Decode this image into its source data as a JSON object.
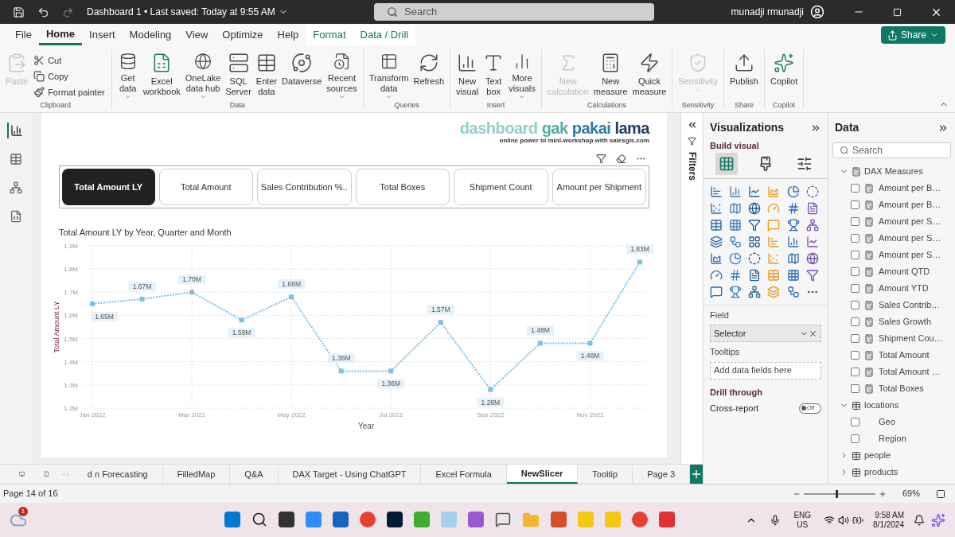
{
  "title_bar": {
    "document": "Dashboard 1 • Last saved: Today at 9:55 AM",
    "search": {
      "placeholder": "Search"
    },
    "user": "munadji rmunadji"
  },
  "menu_tabs": [
    {
      "label": "File",
      "selected": false
    },
    {
      "label": "Home",
      "selected": true
    },
    {
      "label": "Insert",
      "selected": false
    },
    {
      "label": "Modeling",
      "selected": false
    },
    {
      "label": "View",
      "selected": false
    },
    {
      "label": "Optimize",
      "selected": false
    },
    {
      "label": "Help",
      "selected": false
    },
    {
      "label": "Format",
      "selected": false,
      "kind": "contextual"
    },
    {
      "label": "Data / Drill",
      "selected": false,
      "kind": "contextual"
    }
  ],
  "share_button": "Share",
  "ribbon": [
    {
      "group": "Clipboard",
      "buttons": [
        {
          "kind": "large",
          "lines": [
            "Paste"
          ],
          "disabled": true,
          "dropdown": false
        },
        {
          "kind": "small",
          "lines": [
            "Cut"
          ],
          "disabled": false
        },
        {
          "kind": "small",
          "lines": [
            "Copy"
          ],
          "disabled": false
        },
        {
          "kind": "small",
          "lines": [
            "Format painter"
          ],
          "disabled": false
        }
      ]
    },
    {
      "group": "Data",
      "buttons": [
        {
          "kind": "large",
          "lines": [
            "Get",
            "data"
          ],
          "disabled": false,
          "dropdown": true
        },
        {
          "kind": "large",
          "lines": [
            "Excel",
            "workbook"
          ],
          "disabled": false,
          "dropdown": false
        },
        {
          "kind": "large",
          "lines": [
            "OneLake",
            "data hub"
          ],
          "disabled": false,
          "dropdown": true
        },
        {
          "kind": "large",
          "lines": [
            "SQL",
            "Server"
          ],
          "disabled": false,
          "dropdown": false
        },
        {
          "kind": "large",
          "lines": [
            "Enter",
            "data"
          ],
          "disabled": false,
          "dropdown": false
        },
        {
          "kind": "large",
          "lines": [
            "Dataverse"
          ],
          "disabled": false,
          "dropdown": false
        },
        {
          "kind": "large",
          "lines": [
            "Recent",
            "sources"
          ],
          "disabled": false,
          "dropdown": true
        }
      ]
    },
    {
      "group": "Queries",
      "buttons": [
        {
          "kind": "large",
          "lines": [
            "Transform",
            "data"
          ],
          "disabled": false,
          "dropdown": true
        },
        {
          "kind": "large",
          "lines": [
            "Refresh"
          ],
          "disabled": false,
          "dropdown": false
        }
      ]
    },
    {
      "group": "Insert",
      "buttons": [
        {
          "kind": "large",
          "lines": [
            "New",
            "visual"
          ],
          "disabled": false,
          "dropdown": false
        },
        {
          "kind": "large",
          "lines": [
            "Text",
            "box"
          ],
          "disabled": false,
          "dropdown": false
        },
        {
          "kind": "large",
          "lines": [
            "More",
            "visuals"
          ],
          "disabled": false,
          "dropdown": true
        }
      ]
    },
    {
      "group": "Calculations",
      "buttons": [
        {
          "kind": "large",
          "lines": [
            "New",
            "calculation"
          ],
          "disabled": true,
          "dropdown": false
        },
        {
          "kind": "large",
          "lines": [
            "New",
            "measure"
          ],
          "disabled": false,
          "dropdown": false
        },
        {
          "kind": "large",
          "lines": [
            "Quick",
            "measure"
          ],
          "disabled": false,
          "dropdown": false
        }
      ]
    },
    {
      "group": "Sensitivity",
      "buttons": [
        {
          "kind": "large",
          "lines": [
            "Sensitivity"
          ],
          "disabled": true,
          "dropdown": true
        }
      ]
    },
    {
      "group": "Share",
      "buttons": [
        {
          "kind": "large",
          "lines": [
            "Publish"
          ],
          "disabled": false,
          "dropdown": false
        }
      ]
    },
    {
      "group": "Copilot",
      "buttons": [
        {
          "kind": "large",
          "lines": [
            "Copilot"
          ],
          "disabled": false,
          "dropdown": false
        }
      ]
    }
  ],
  "left_nav": [
    {
      "selected": true
    },
    {
      "selected": false
    },
    {
      "selected": false
    },
    {
      "selected": false
    }
  ],
  "report": {
    "logo": {
      "title": "dashboard gak pakai lama",
      "tagline": "online power bi mini-workshop with salesgis.com"
    },
    "slicer": [
      {
        "label": "Total Amount LY",
        "selected": true
      },
      {
        "label": "Total Amount",
        "selected": false
      },
      {
        "label": "Sales Contribution %..",
        "selected": false
      },
      {
        "label": "Total Boxes",
        "selected": false
      },
      {
        "label": "Shipment Count",
        "selected": false
      },
      {
        "label": "Amount per Shipment",
        "selected": false
      }
    ],
    "chart": {
      "title": "Total Amount LY by Year, Quarter and Month",
      "chart_data": {
        "type": "line",
        "xlabel": "Year",
        "ylabel": "Total Amount LY",
        "categories": [
          "Jan 2022",
          null,
          "Mar 2022",
          null,
          "May 2022",
          null,
          "Jul 2022",
          null,
          "Sep 2022",
          null,
          "Nov 2022",
          null
        ],
        "grid": true,
        "series": [
          {
            "color": "#7cc0e8",
            "line_style": "dotted",
            "marker": "square",
            "values": [
              1.65,
              1.67,
              1.7,
              1.58,
              1.68,
              1.36,
              1.36,
              1.57,
              1.28,
              1.48,
              1.48,
              1.83
            ]
          }
        ],
        "ylim": [
          1.2,
          1.9
        ],
        "yticks": [
          {
            "value": 1.2,
            "label": "1.2M"
          },
          {
            "value": 1.3,
            "label": "1.3M"
          },
          {
            "value": 1.4,
            "label": "1.4M"
          },
          {
            "value": 1.5,
            "label": "1.5M"
          },
          {
            "value": 1.6,
            "label": "1.6M"
          },
          {
            "value": 1.7,
            "label": "1.7M"
          },
          {
            "value": 1.8,
            "label": "1.8M"
          },
          {
            "value": 1.9,
            "label": "1.9M"
          }
        ],
        "value_labels": [
          "1.65M",
          "1.67M",
          "1.70M",
          "1.58M",
          "1.68M",
          "1.36M",
          "1.36M",
          "1.57M",
          "1.28M",
          "1.48M",
          "1.48M",
          "1.83M"
        ]
      }
    }
  },
  "filters_pane": {
    "title": "Filters"
  },
  "visualizations": {
    "title": "Visualizations",
    "subtitle": "Build visual",
    "build_tabs": [
      {
        "selected": true
      },
      {
        "selected": false
      },
      {
        "selected": false
      }
    ],
    "wells": [
      {
        "kind": "field",
        "label": "Field",
        "value": "Selector"
      },
      {
        "kind": "empty",
        "label": "Tooltips",
        "placeholder": "Add data fields here"
      }
    ],
    "drill_through": {
      "title": "Drill through",
      "toggles": [
        {
          "label": "Cross-report",
          "on": false,
          "state_text": "Off"
        }
      ]
    }
  },
  "data_pane": {
    "title": "Data",
    "search": {
      "placeholder": "Search"
    },
    "tables": [
      {
        "name": "DAX Measures",
        "kind": "measures",
        "expanded": true,
        "children": [
          {
            "name": "Amount per B…",
            "kind": "measure",
            "checked": false
          },
          {
            "name": "Amount per B…",
            "kind": "measure",
            "checked": false
          },
          {
            "name": "Amount per S…",
            "kind": "measure",
            "checked": false
          },
          {
            "name": "Amount per S…",
            "kind": "measure",
            "checked": false
          },
          {
            "name": "Amount per S…",
            "kind": "measure",
            "checked": false
          },
          {
            "name": "Amount QTD",
            "kind": "measure",
            "checked": false
          },
          {
            "name": "Amount YTD",
            "kind": "measure",
            "checked": false
          },
          {
            "name": "Sales Contrib…",
            "kind": "measure",
            "checked": false
          },
          {
            "name": "Sales Growth",
            "kind": "measure",
            "checked": false
          },
          {
            "name": "Shipment Cou…",
            "kind": "measure",
            "checked": false
          },
          {
            "name": "Total Amount",
            "kind": "measure",
            "checked": false
          },
          {
            "name": "Total Amount …",
            "kind": "measure",
            "checked": false
          },
          {
            "name": "Total Boxes",
            "kind": "measure",
            "checked": false
          }
        ]
      },
      {
        "name": "locations",
        "kind": "table",
        "expanded": true,
        "children": [
          {
            "name": "Geo",
            "kind": "column",
            "checked": false
          },
          {
            "name": "Region",
            "kind": "column",
            "checked": false
          }
        ]
      },
      {
        "name": "people",
        "kind": "table",
        "expanded": false
      },
      {
        "name": "products",
        "kind": "table",
        "expanded": false
      }
    ]
  },
  "page_tabs": [
    {
      "label": "d n Forecasting",
      "selected": false
    },
    {
      "label": "FilledMap",
      "selected": false
    },
    {
      "label": "Q&A",
      "selected": false
    },
    {
      "label": "DAX Target - Using ChatGPT",
      "selected": false
    },
    {
      "label": "Excel Formula",
      "selected": false
    },
    {
      "label": "NewSlicer",
      "selected": true
    },
    {
      "label": "Tooltip",
      "selected": false
    },
    {
      "label": "Page 3",
      "selected": false
    }
  ],
  "status_bar": {
    "page": "Page 14 of 16",
    "zoom": {
      "level": 0.45,
      "reading": "69%"
    }
  },
  "taskbar": {
    "weather_badge": "1",
    "language": "ENG",
    "region": "US",
    "time": "9:58 AM",
    "date": "8/1/2024"
  }
}
